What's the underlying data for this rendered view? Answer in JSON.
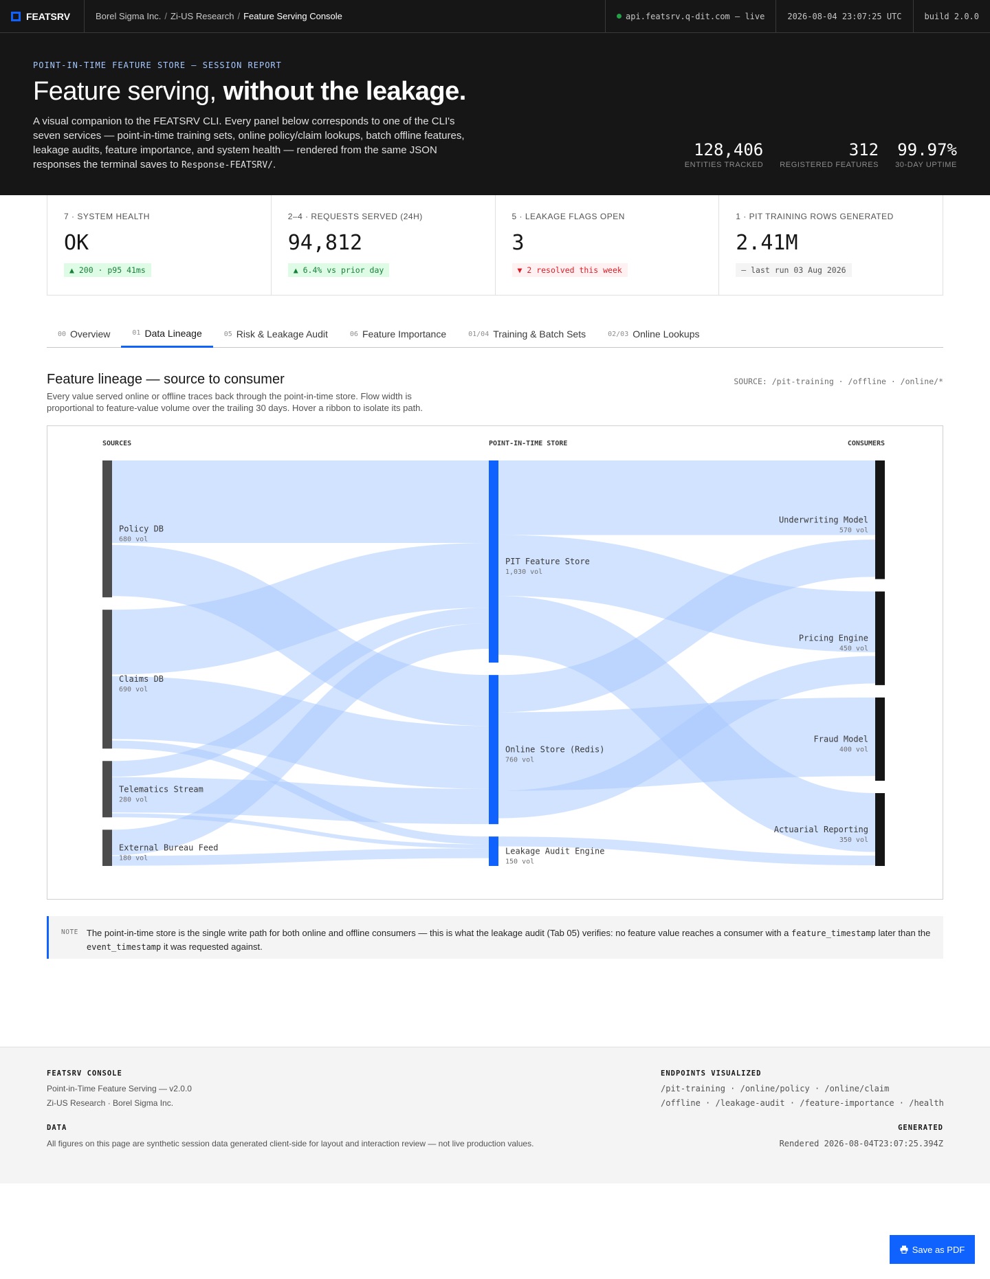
{
  "topbar": {
    "brand": "FEATSRV",
    "crumbs": [
      "Borel Sigma Inc.",
      "Zi-US Research",
      "Feature Serving Console"
    ],
    "endpoint": "api.featsrv.q-dit.com — live",
    "timestamp": "2026-08-04 23:07:25 UTC",
    "build": "build 2.0.0"
  },
  "hero": {
    "eyebrow": "POINT-IN-TIME FEATURE STORE — SESSION REPORT",
    "title_plain": "Feature serving, ",
    "title_bold": "without the leakage.",
    "lede_text": "A visual companion to the FEATSRV CLI. Every panel below corresponds to one of the CLI's seven services — point-in-time training sets, online policy/claim lookups, batch offline features, leakage audits, feature importance, and system health — rendered from the same JSON responses the terminal saves to ",
    "lede_code": "Response-FEATSRV/",
    "lede_end": ".",
    "stats": [
      {
        "value": "128,406",
        "label": "ENTITIES TRACKED"
      },
      {
        "value": "312",
        "label": "REGISTERED FEATURES"
      },
      {
        "value": "99.97%",
        "label": "30-DAY UPTIME"
      }
    ]
  },
  "kpis": [
    {
      "label": "7 · SYSTEM HEALTH",
      "value": "OK",
      "chip": "▲ 200 · p95 41ms",
      "tone": "up"
    },
    {
      "label": "2–4 · REQUESTS SERVED (24H)",
      "value": "94,812",
      "chip": "▲ 6.4% vs prior day",
      "tone": "up"
    },
    {
      "label": "5 · LEAKAGE FLAGS OPEN",
      "value": "3",
      "chip": "▼ 2 resolved this week",
      "tone": "down"
    },
    {
      "label": "1 · PIT TRAINING ROWS GENERATED",
      "value": "2.41M",
      "chip": "— last run 03 Aug 2026",
      "tone": "flat"
    }
  ],
  "tabs": [
    {
      "num": "00",
      "label": "Overview"
    },
    {
      "num": "01",
      "label": "Data Lineage"
    },
    {
      "num": "05",
      "label": "Risk & Leakage Audit"
    },
    {
      "num": "06",
      "label": "Feature Importance"
    },
    {
      "num": "01/04",
      "label": "Training & Batch Sets"
    },
    {
      "num": "02/03",
      "label": "Online Lookups"
    }
  ],
  "section": {
    "title": "Feature lineage — source to consumer",
    "desc": "Every value served online or offline traces back through the point-in-time store. Flow width is proportional to feature-value volume over the trailing 30 days. Hover a ribbon to isolate its path.",
    "source": "SOURCE: /pit-training · /offline · /online/*"
  },
  "chart_data": {
    "type": "sankey",
    "columns": [
      "SOURCES",
      "POINT-IN-TIME STORE",
      "CONSUMERS"
    ],
    "unit": "vol",
    "nodes": [
      {
        "id": "policy",
        "name": "Policy DB",
        "column": 0,
        "value": 680,
        "label": "680 vol"
      },
      {
        "id": "claims",
        "name": "Claims DB",
        "column": 0,
        "value": 690,
        "label": "690 vol"
      },
      {
        "id": "tele",
        "name": "Telematics Stream",
        "column": 0,
        "value": 280,
        "label": "280 vol"
      },
      {
        "id": "bureau",
        "name": "External Bureau Feed",
        "column": 0,
        "value": 180,
        "label": "180 vol"
      },
      {
        "id": "pit",
        "name": "PIT Feature Store",
        "column": 1,
        "value": 1030,
        "label": "1,030 vol"
      },
      {
        "id": "online",
        "name": "Online Store (Redis)",
        "column": 1,
        "value": 760,
        "label": "760 vol"
      },
      {
        "id": "audit",
        "name": "Leakage Audit Engine",
        "column": 1,
        "value": 150,
        "label": "150 vol"
      },
      {
        "id": "uw",
        "name": "Underwriting Model",
        "column": 2,
        "value": 570,
        "label": "570 vol"
      },
      {
        "id": "pricing",
        "name": "Pricing Engine",
        "column": 2,
        "value": 450,
        "label": "450 vol"
      },
      {
        "id": "fraud",
        "name": "Fraud Model",
        "column": 2,
        "value": 400,
        "label": "400 vol"
      },
      {
        "id": "act",
        "name": "Actuarial Reporting",
        "column": 2,
        "value": 350,
        "label": "350 vol"
      }
    ],
    "links": [
      {
        "source": "policy",
        "target": "pit",
        "value": 420
      },
      {
        "source": "policy",
        "target": "online",
        "value": 260
      },
      {
        "source": "claims",
        "target": "pit",
        "value": 330
      },
      {
        "source": "claims",
        "target": "online",
        "value": 320
      },
      {
        "source": "claims",
        "target": "audit",
        "value": 40
      },
      {
        "source": "tele",
        "target": "pit",
        "value": 80
      },
      {
        "source": "tele",
        "target": "online",
        "value": 180
      },
      {
        "source": "tele",
        "target": "audit",
        "value": 20
      },
      {
        "source": "bureau",
        "target": "pit",
        "value": 130
      },
      {
        "source": "bureau",
        "target": "audit",
        "value": 50
      },
      {
        "source": "pit",
        "target": "uw",
        "value": 380
      },
      {
        "source": "pit",
        "target": "pricing",
        "value": 310
      },
      {
        "source": "pit",
        "target": "act",
        "value": 300
      },
      {
        "source": "online",
        "target": "uw",
        "value": 190
      },
      {
        "source": "online",
        "target": "fraud",
        "value": 400
      },
      {
        "source": "online",
        "target": "pricing",
        "value": 140
      },
      {
        "source": "audit",
        "target": "act",
        "value": 50
      }
    ],
    "colors": {
      "source_bar": "#4c4c4c",
      "store_bar": "#0f62fe",
      "consumer_bar": "#161616",
      "ribbon": "#a6c8ff"
    }
  },
  "note": {
    "tag": "NOTE",
    "text1": "The point-in-time store is the single write path for both online and offline consumers — this is what the leakage audit (Tab 05) verifies: no feature value reaches a consumer with a ",
    "code1": "feature_timestamp",
    "text2": " later than the ",
    "code2": "event_timestamp",
    "text3": " it was requested against."
  },
  "footer": {
    "console_h": "FEATSRV CONSOLE",
    "console_l1": "Point-in-Time Feature Serving — v2.0.0",
    "console_l2": "Zi-US Research · Borel Sigma Inc.",
    "data_h": "DATA",
    "data_t": "All figures on this page are synthetic session data generated client-side for layout and interaction review — not live production values.",
    "endpoints_h": "ENDPOINTS VISUALIZED",
    "endpoints_l1": "/pit-training · /online/policy · /online/claim",
    "endpoints_l2": "/offline · /leakage-audit · /feature-importance · /health",
    "generated_h": "GENERATED",
    "generated_t": "Rendered 2026-08-04T23:07:25.394Z"
  },
  "pdf_button": "Save as PDF",
  "icons": {
    "brand": "square-logo-icon",
    "status": "live-dot-icon",
    "pdf": "printer-icon"
  }
}
